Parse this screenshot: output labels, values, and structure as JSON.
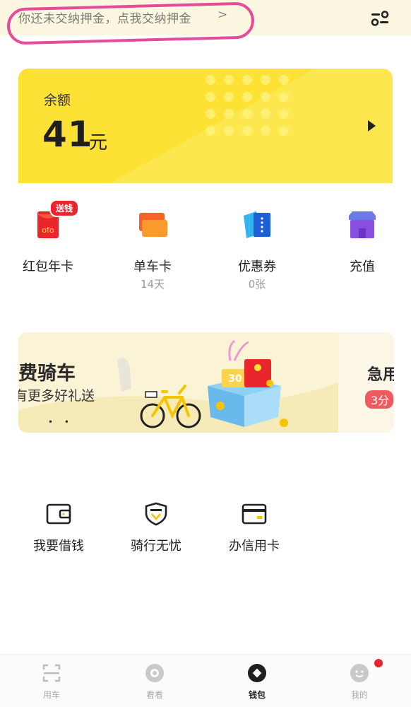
{
  "notice": {
    "text": "你还未交纳押金，点我交纳押金",
    "arrow": ">"
  },
  "balance": {
    "label": "余额",
    "amount": "41",
    "unit": "元"
  },
  "quick_items": [
    {
      "label": "红包年卡",
      "sub": "",
      "badge": "送钱",
      "icon": "red-envelope-icon"
    },
    {
      "label": "单车卡",
      "sub": "14天",
      "icon": "bike-card-icon"
    },
    {
      "label": "优惠券",
      "sub": "0张",
      "icon": "coupon-icon"
    },
    {
      "label": "充值",
      "sub": "",
      "icon": "recharge-store-icon"
    }
  ],
  "banner": {
    "title": "费骑车",
    "subtitle": "有更多好礼送",
    "coupon_value": "30"
  },
  "banner2": {
    "title": "急用",
    "badge": "3分"
  },
  "services": [
    {
      "label": "我要借钱",
      "icon": "wallet-icon"
    },
    {
      "label": "骑行无忧",
      "icon": "shield-icon"
    },
    {
      "label": "办信用卡",
      "icon": "credit-card-icon"
    }
  ],
  "tabs": [
    {
      "label": "用车",
      "icon": "scan-icon",
      "active": false
    },
    {
      "label": "看看",
      "icon": "eye-icon",
      "active": false
    },
    {
      "label": "钱包",
      "icon": "wallet-tab-icon",
      "active": true
    },
    {
      "label": "我的",
      "icon": "profile-face-icon",
      "active": false
    }
  ],
  "colors": {
    "accent_yellow": "#fde135",
    "badge_red": "#e8262b",
    "highlight_pink": "#e64a9b"
  }
}
